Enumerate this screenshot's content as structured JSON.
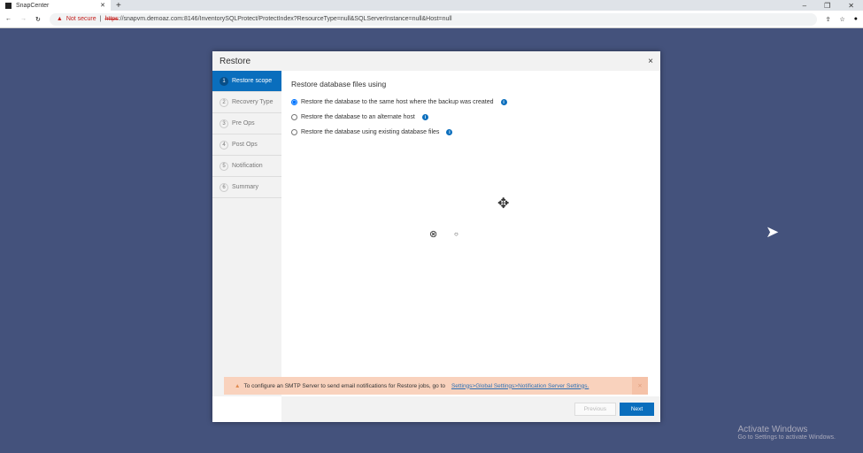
{
  "browser": {
    "tab_title": "SnapCenter",
    "not_secure": "Not secure",
    "url_scheme": "https",
    "url_rest": "://snapvm.demoaz.com:8146/InventorySQLProtect/ProtectIndex?ResourceType=null&SQLServerInstance=null&Host=null"
  },
  "dialog": {
    "title": "Restore",
    "close": "×",
    "steps": [
      {
        "num": "1",
        "label": "Restore scope"
      },
      {
        "num": "2",
        "label": "Recovery Type"
      },
      {
        "num": "3",
        "label": "Pre Ops"
      },
      {
        "num": "4",
        "label": "Post Ops"
      },
      {
        "num": "5",
        "label": "Notification"
      },
      {
        "num": "6",
        "label": "Summary"
      }
    ],
    "heading": "Restore database files using",
    "options": [
      "Restore the database to the same host where the backup was created",
      "Restore the database to an alternate host",
      "Restore the database using existing database files"
    ],
    "warning": "To configure an SMTP Server to send email notifications for Restore jobs, go to",
    "warning_link": "Settings>Global Settings>Notification Server Settings.",
    "previous": "Previous",
    "next": "Next"
  },
  "watermark": {
    "title": "Activate Windows",
    "sub": "Go to Settings to activate Windows."
  }
}
